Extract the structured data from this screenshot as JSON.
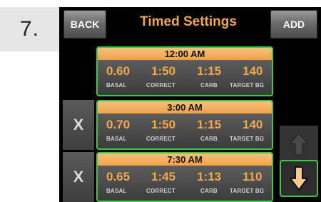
{
  "step": "7.",
  "header": {
    "back_label": "BACK",
    "title": "Timed Settings",
    "add_label": "ADD"
  },
  "labels": {
    "basal": "BASAL",
    "correct": "CORRECT",
    "carb": "CARB",
    "target": "TARGET BG"
  },
  "delete_label": "X",
  "entries": [
    {
      "time": "12:00 AM",
      "basal": "0.60",
      "correct": "1:50",
      "carb": "1:15",
      "target": "140"
    },
    {
      "time": "3:00 AM",
      "basal": "0.70",
      "correct": "1:50",
      "carb": "1:15",
      "target": "140"
    },
    {
      "time": "7:30 AM",
      "basal": "0.65",
      "correct": "1:45",
      "carb": "1:13",
      "target": "110"
    }
  ],
  "colors": {
    "accent": "#f3a84a",
    "highlight": "#3ccb3c",
    "header_bar": "#f1a24a"
  },
  "icons": {
    "scroll_up": "arrow-up-icon",
    "scroll_down": "arrow-down-icon"
  }
}
